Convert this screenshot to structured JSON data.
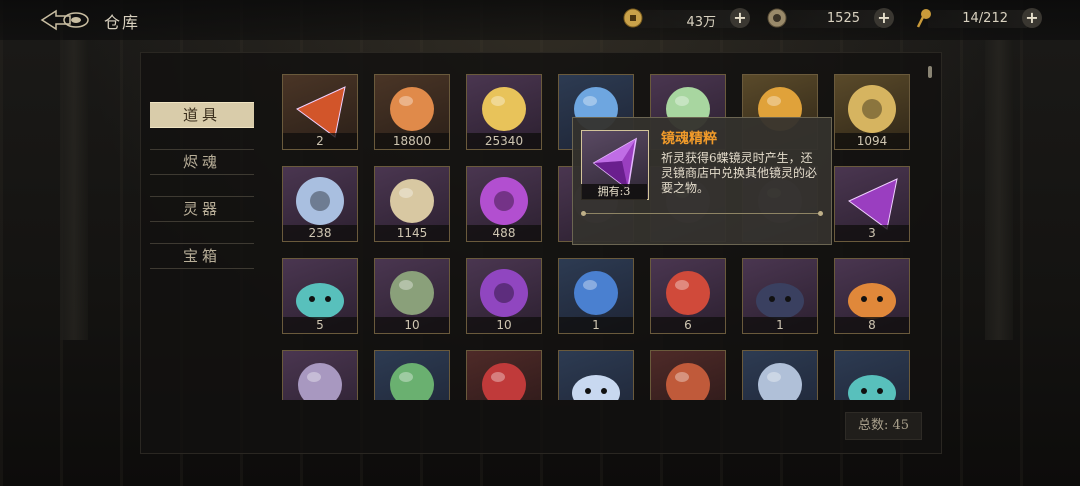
{
  "header": {
    "title": "仓库",
    "resources": [
      {
        "icon": "coin-icon",
        "value": "43万"
      },
      {
        "icon": "spirit-coin-icon",
        "value": "1525"
      },
      {
        "icon": "pin-icon",
        "value": "14/212"
      }
    ]
  },
  "sidebar": {
    "items": [
      {
        "label": "道具",
        "active": true
      },
      {
        "label": "烬魂",
        "active": false
      },
      {
        "label": "灵器",
        "active": false
      },
      {
        "label": "宝箱",
        "active": false
      }
    ]
  },
  "inventory": {
    "rows": [
      [
        {
          "icon": "ember-shard-icon",
          "count": "2",
          "tone": "brown"
        },
        {
          "icon": "dragon-egg-icon",
          "count": "18800",
          "tone": "brown"
        },
        {
          "icon": "golden-egg-icon",
          "count": "25340",
          "tone": "purple"
        },
        {
          "icon": "blue-crystal-icon",
          "count": "",
          "tone": "blue"
        },
        {
          "icon": "lotus-icon",
          "count": "",
          "tone": "purple"
        },
        {
          "icon": "feather-icon",
          "count": "",
          "tone": "gold"
        },
        {
          "icon": "gold-emblem-icon",
          "count": "1094",
          "tone": "gold"
        }
      ],
      [
        {
          "icon": "silver-emblem-icon",
          "count": "238",
          "tone": "purple"
        },
        {
          "icon": "scroll-icon",
          "count": "1145",
          "tone": "purple"
        },
        {
          "icon": "purple-orb-icon",
          "count": "488",
          "tone": "purple"
        },
        {
          "icon": "hidden-item-icon",
          "count": "",
          "tone": "purple"
        },
        {
          "icon": "hidden-item-icon",
          "count": "",
          "tone": "purple"
        },
        {
          "icon": "hidden-item-icon",
          "count": "",
          "tone": "purple"
        },
        {
          "icon": "purple-gem-icon",
          "count": "3",
          "tone": "purple"
        }
      ],
      [
        {
          "icon": "teal-creature-icon",
          "count": "5",
          "tone": "purple"
        },
        {
          "icon": "book-vine-icon",
          "count": "10",
          "tone": "purple"
        },
        {
          "icon": "purple-swirl-icon",
          "count": "10",
          "tone": "purple"
        },
        {
          "icon": "blue-dragon-stone-icon",
          "count": "1",
          "tone": "blue"
        },
        {
          "icon": "koi-icon",
          "count": "6",
          "tone": "purple"
        },
        {
          "icon": "dark-creature-icon",
          "count": "1",
          "tone": "purple"
        },
        {
          "icon": "orange-creature-icon",
          "count": "8",
          "tone": "purple"
        }
      ],
      [
        {
          "icon": "rune-card-icon",
          "count": "",
          "tone": "purple"
        },
        {
          "icon": "vine-icon",
          "count": "",
          "tone": "blue"
        },
        {
          "icon": "red-flower-icon",
          "count": "",
          "tone": "red"
        },
        {
          "icon": "white-creature-icon",
          "count": "",
          "tone": "blue"
        },
        {
          "icon": "red-egg-icon",
          "count": "",
          "tone": "red"
        },
        {
          "icon": "crystal-cluster-icon",
          "count": "",
          "tone": "blue"
        },
        {
          "icon": "teal-creature-icon",
          "count": "",
          "tone": "blue"
        }
      ]
    ],
    "total": "总数: 45"
  },
  "tooltip": {
    "name": "镜魂精粹",
    "owned": "拥有:3",
    "description": "祈灵获得6蝶镜灵时产生，还灵镜商店中兑换其他镜灵的必要之物。"
  },
  "colors": {
    "accent": "#f09a2a",
    "active_tab": "#d9ccaa",
    "frame": "#6a5a3c"
  }
}
